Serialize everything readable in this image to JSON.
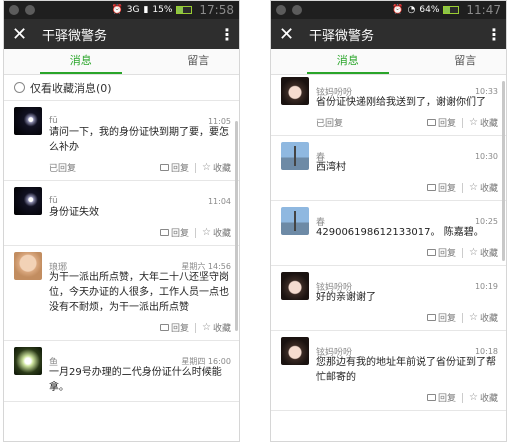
{
  "left": {
    "status": {
      "battery": "15%",
      "network": "3G",
      "time": "17:58"
    },
    "title": "干驿微警务",
    "tabs": [
      "消息",
      "留言"
    ],
    "filter_label": "仅看收藏消息(0)",
    "messages": [
      {
        "name": "fū",
        "time": "11:05",
        "content": "请问一下，我的身份证快到期了要，要怎么补办",
        "replied": "已回复",
        "reply": "回复",
        "fav": "收藏",
        "avatar": "star"
      },
      {
        "name": "fū",
        "time": "11:04",
        "content": "身份证失效",
        "replied": "",
        "reply": "回复",
        "fav": "收藏",
        "avatar": "star"
      },
      {
        "name": "琅琊",
        "time": "星期六 14:56",
        "content": "为干一派出所点赞，大年二十八还坚守岗位，今天办证的人很多，工作人员一点也没有不耐烦，为干一派出所点赞",
        "replied": "",
        "reply": "回复",
        "fav": "收藏",
        "avatar": "child"
      },
      {
        "name": "鱼",
        "time": "星期四 16:00",
        "content": "一月29号办理的二代身份证什么时候能拿。",
        "replied": "",
        "reply": "",
        "fav": "",
        "avatar": "glow"
      }
    ]
  },
  "right": {
    "status": {
      "battery": "64%",
      "time": "11:47"
    },
    "title": "干驿微警务",
    "tabs": [
      "消息",
      "留言"
    ],
    "messages": [
      {
        "name": "铉妈吩吩",
        "time": "10:33",
        "content": "省份证快递刚给我送到了，谢谢你们了",
        "replied": "已回复",
        "reply": "回复",
        "fav": "收藏",
        "avatar": "girl"
      },
      {
        "name": "春",
        "time": "10:30",
        "content": "西湾村",
        "replied": "",
        "reply": "回复",
        "fav": "收藏",
        "avatar": "tower"
      },
      {
        "name": "春",
        "time": "10:25",
        "content": "429006198612133017。 陈嘉碧。",
        "replied": "",
        "reply": "回复",
        "fav": "收藏",
        "avatar": "tower"
      },
      {
        "name": "铉妈吩吩",
        "time": "10:19",
        "content": "好的亲谢谢了",
        "replied": "",
        "reply": "回复",
        "fav": "收藏",
        "avatar": "girl"
      },
      {
        "name": "铉妈吩吩",
        "time": "10:18",
        "content": "您那边有我的地址年前说了省份证到了帮忙邮寄的",
        "replied": "",
        "reply": "回复",
        "fav": "收藏",
        "avatar": "girl"
      }
    ]
  }
}
